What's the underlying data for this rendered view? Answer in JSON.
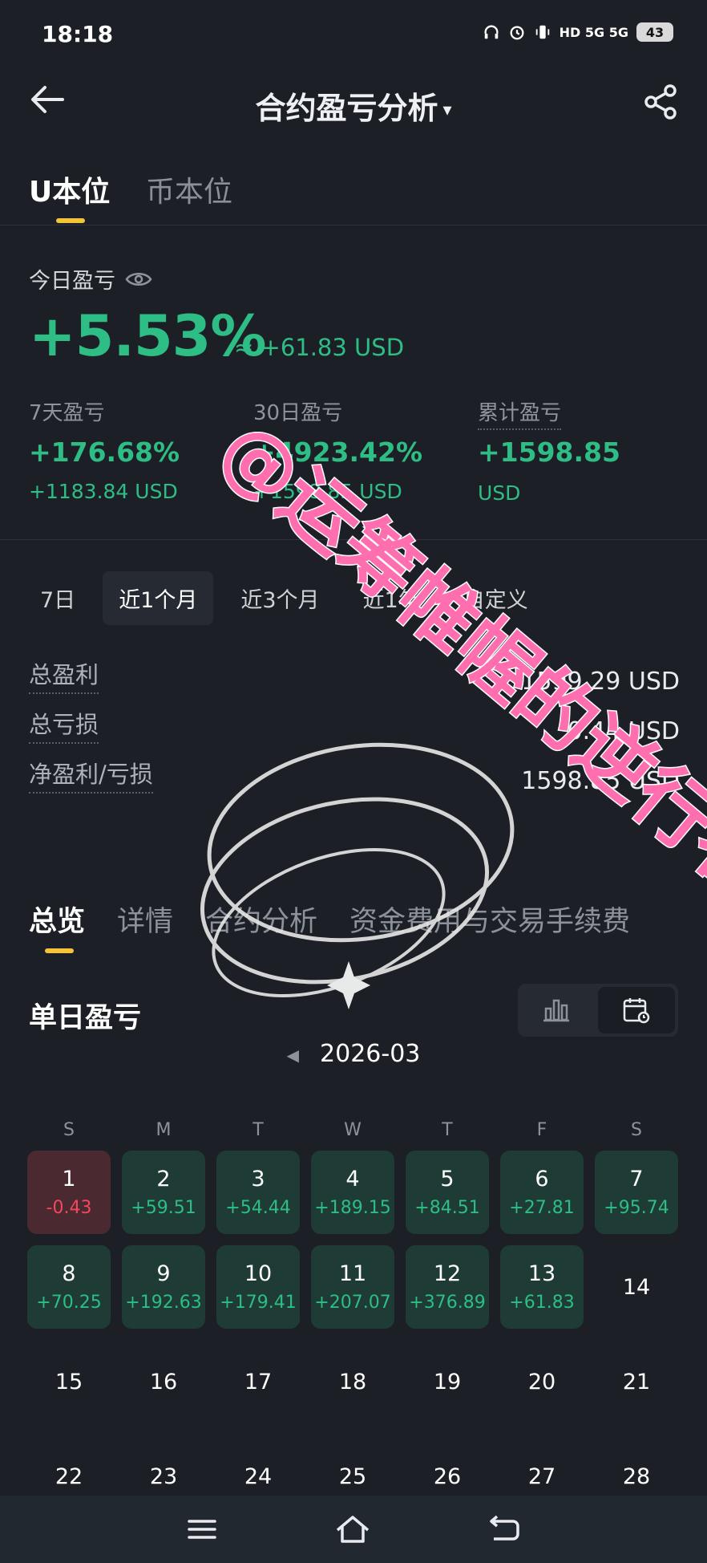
{
  "status_bar": {
    "time": "18:18",
    "network": "HD 5G 5G",
    "battery": "43"
  },
  "header": {
    "title": "合约盈亏分析",
    "caret": "▾"
  },
  "top_tabs": {
    "u_based": "U本位",
    "coin_based": "币本位"
  },
  "today": {
    "label": "今日盈亏",
    "percent": "+5.53%",
    "usd": "≈ +61.83 USD"
  },
  "stats": [
    {
      "label": "7天盈亏",
      "value": "+176.68%",
      "sub": "+1183.84 USD"
    },
    {
      "label": "30日盈亏",
      "value": "+4923.42%",
      "sub": "+1598.85 USD"
    },
    {
      "label": "累计盈亏",
      "value": "+1598.85",
      "sub": "USD"
    }
  ],
  "periods": [
    "7日",
    "近1个月",
    "近3个月",
    "近1年",
    "自定义"
  ],
  "summary": [
    {
      "label": "总盈利",
      "value": "1599.29 USD"
    },
    {
      "label": "总亏损",
      "value": "0.44 USD"
    },
    {
      "label": "净盈利/亏损",
      "value": "1598.85 USD"
    }
  ],
  "section_tabs": [
    "总览",
    "详情",
    "合约分析",
    "资金费用与交易手续费"
  ],
  "daily": {
    "title": "单日盈亏",
    "month": "2026-03",
    "prev_arrow": "◀"
  },
  "weekdays": [
    "S",
    "M",
    "T",
    "W",
    "T",
    "F",
    "S"
  ],
  "calendar": [
    {
      "day": "1",
      "pnl": "-0.43",
      "type": "neg"
    },
    {
      "day": "2",
      "pnl": "+59.51",
      "type": "pos"
    },
    {
      "day": "3",
      "pnl": "+54.44",
      "type": "pos"
    },
    {
      "day": "4",
      "pnl": "+189.15",
      "type": "pos"
    },
    {
      "day": "5",
      "pnl": "+84.51",
      "type": "pos"
    },
    {
      "day": "6",
      "pnl": "+27.81",
      "type": "pos"
    },
    {
      "day": "7",
      "pnl": "+95.74",
      "type": "pos"
    },
    {
      "day": "8",
      "pnl": "+70.25",
      "type": "pos"
    },
    {
      "day": "9",
      "pnl": "+192.63",
      "type": "pos"
    },
    {
      "day": "10",
      "pnl": "+179.41",
      "type": "pos"
    },
    {
      "day": "11",
      "pnl": "+207.07",
      "type": "pos"
    },
    {
      "day": "12",
      "pnl": "+376.89",
      "type": "pos"
    },
    {
      "day": "13",
      "pnl": "+61.83",
      "type": "pos"
    },
    {
      "day": "14",
      "pnl": "",
      "type": "none"
    },
    {
      "day": "15",
      "pnl": "",
      "type": "none"
    },
    {
      "day": "16",
      "pnl": "",
      "type": "none"
    },
    {
      "day": "17",
      "pnl": "",
      "type": "none"
    },
    {
      "day": "18",
      "pnl": "",
      "type": "none"
    },
    {
      "day": "19",
      "pnl": "",
      "type": "none"
    },
    {
      "day": "20",
      "pnl": "",
      "type": "none"
    },
    {
      "day": "21",
      "pnl": "",
      "type": "none"
    },
    {
      "day": "22",
      "pnl": "",
      "type": "none"
    },
    {
      "day": "23",
      "pnl": "",
      "type": "none"
    },
    {
      "day": "24",
      "pnl": "",
      "type": "none"
    },
    {
      "day": "25",
      "pnl": "",
      "type": "none"
    },
    {
      "day": "26",
      "pnl": "",
      "type": "none"
    },
    {
      "day": "27",
      "pnl": "",
      "type": "none"
    },
    {
      "day": "28",
      "pnl": "",
      "type": "none"
    }
  ],
  "watermark_text": "@运筹帷幄的逆行者",
  "colors": {
    "background": "#1c2026",
    "profit": "#2dbd85",
    "loss": "#f5475c",
    "accent": "#f3c43a",
    "watermark": "#ff5fa8"
  }
}
